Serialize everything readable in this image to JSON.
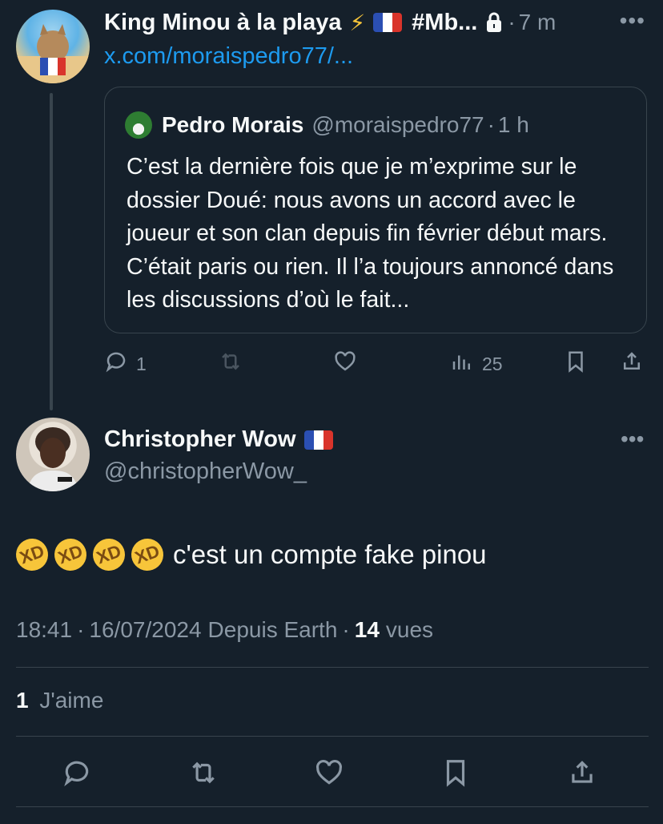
{
  "reply_to": {
    "author_name": "King Minou à la playa",
    "name_emoji": "⚡",
    "name_hashtag": "#Mb...",
    "time_sep": "·",
    "time": "7 m",
    "link": "x.com/moraispedro77/...",
    "more": "•••",
    "quoted": {
      "author_name": "Pedro Morais",
      "handle": "@moraispedro77",
      "time_sep": "·",
      "time": "1 h",
      "text": "C’est la dernière fois que je m’exprime sur le dossier Doué: nous avons un accord avec le joueur et son clan depuis fin février début mars. C’était paris ou rien. Il l’a toujours annoncé dans les discussions d’où le fait..."
    },
    "actions": {
      "replies": "1",
      "views": "25"
    }
  },
  "post": {
    "author_name": "Christopher Wow",
    "handle": "@christopherWow_",
    "more": "•••",
    "text": "c'est un compte fake pinou",
    "emoji_count": 4,
    "time": "18:41",
    "sep1": "·",
    "date": "16/07/2024",
    "source": "Depuis Earth",
    "sep2": "·",
    "views_count": "14",
    "views_label": "vues",
    "likes_count": "1",
    "likes_label": "J'aime"
  },
  "colors": {
    "background": "#15202b",
    "text": "#f7f9f9",
    "muted": "#8b98a5",
    "link": "#1d9bf0",
    "border": "#38444d"
  },
  "icons": [
    "reply-icon",
    "retweet-icon",
    "like-icon",
    "views-icon",
    "bookmark-icon",
    "share-icon",
    "lock-icon",
    "more-icon"
  ]
}
